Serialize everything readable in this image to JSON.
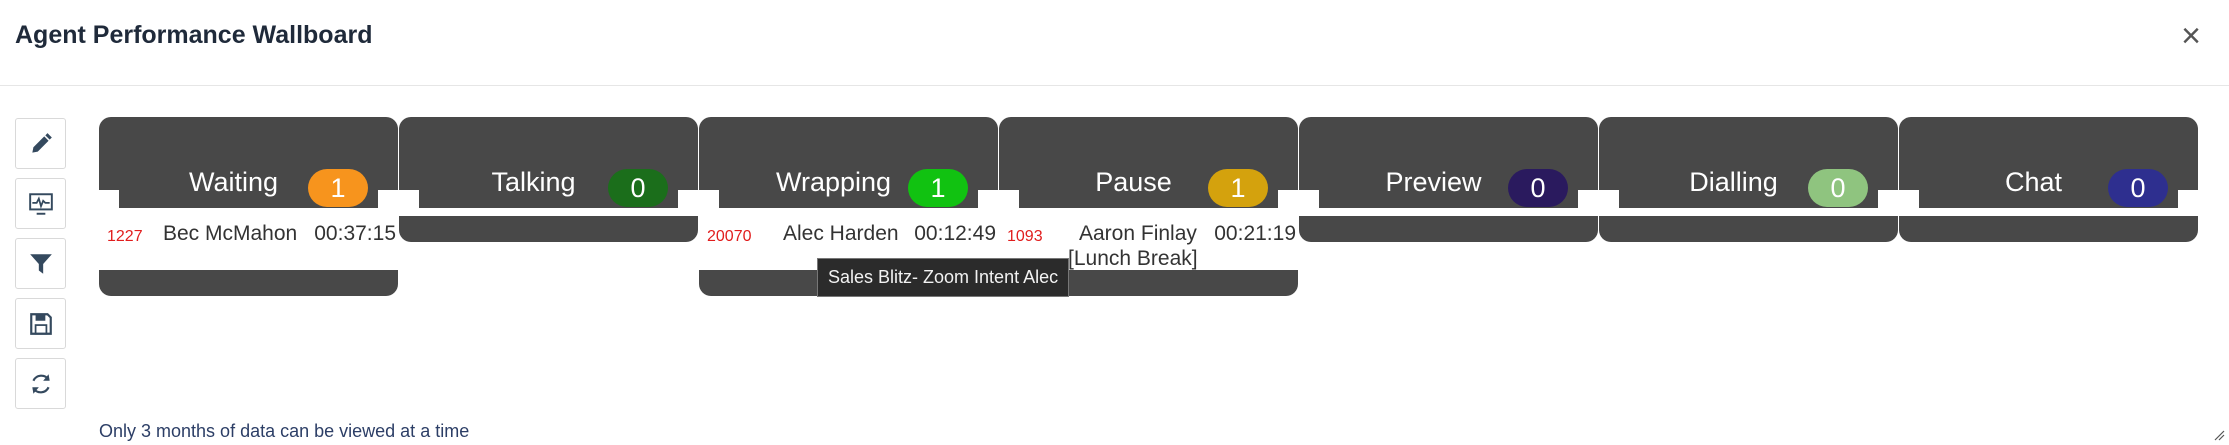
{
  "header": {
    "title": "Agent Performance Wallboard",
    "close_glyph": "×"
  },
  "toolbar": {
    "tools": [
      "edit-icon",
      "monitor-wave-icon",
      "filter-icon",
      "save-icon",
      "refresh-icon"
    ]
  },
  "columns": [
    {
      "name": "Waiting",
      "count": "1",
      "badge_color": "#f7941d",
      "agents": [
        {
          "ext": "1227",
          "name": "Bec McMahon",
          "time": "00:37:15",
          "status": ""
        }
      ]
    },
    {
      "name": "Talking",
      "count": "0",
      "badge_color": "#1b6e1b",
      "agents": []
    },
    {
      "name": "Wrapping",
      "count": "1",
      "badge_color": "#11c211",
      "agents": [
        {
          "ext": "20070",
          "name": "Alec Harden",
          "time": "00:12:49",
          "status": ""
        }
      ]
    },
    {
      "name": "Pause",
      "count": "1",
      "badge_color": "#d4a20d",
      "agents": [
        {
          "ext": "1093",
          "name": "Aaron Finlay",
          "time": "00:21:19",
          "status": "[Lunch Break]"
        }
      ]
    },
    {
      "name": "Preview",
      "count": "0",
      "badge_color": "#2a1a5e",
      "agents": []
    },
    {
      "name": "Dialling",
      "count": "0",
      "badge_color": "#8fc47f",
      "agents": []
    },
    {
      "name": "Chat",
      "count": "0",
      "badge_color": "#2e2f8f",
      "agents": []
    }
  ],
  "tooltip": {
    "text": "Sales Blitz- Zoom Intent Alec"
  },
  "footer": {
    "note": "Only 3 months of data can be viewed at a time"
  }
}
